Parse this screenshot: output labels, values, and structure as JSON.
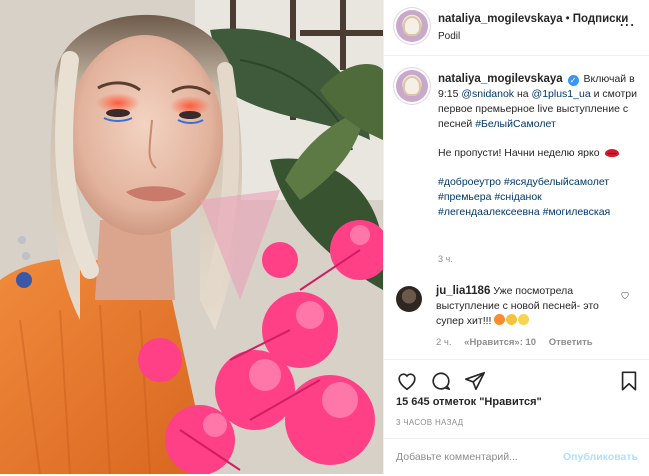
{
  "header": {
    "username": "nataliya_mogilevskaya",
    "separator": "•",
    "follow_label": "Подписки",
    "location": "Podil",
    "more_icon": "more-dots-icon"
  },
  "caption": {
    "username": "nataliya_mogilevskaya",
    "line_a_pre": "Включай в 9:15",
    "mention1": "@snidanok",
    "line_a_mid": "на",
    "mention2": "@1plus1_ua",
    "line_a_post": "и смотри первое премьерное live выступление с песней",
    "hashtag_song": "#БелыйСамолет",
    "line_b": "Не пропусти! Начни неделю ярко",
    "tags": [
      "#доброеутро",
      "#ясядубелыйсамолет",
      "#премьера",
      "#сніданок",
      "#легендаалексеевна",
      "#могилевская"
    ],
    "time": "3 ч."
  },
  "comment": {
    "username": "ju_lia1186",
    "text": "Уже посмотрела выступление с новой песней- это супер хит!!!",
    "time": "2 ч.",
    "likes": "«Нравится»: 10",
    "reply": "Ответить"
  },
  "actions": {
    "like_count": "15 645 отметок",
    "like_word": "\"Нравится\"",
    "posted_ago": "3 ЧАСОВ НАЗАД",
    "comment_placeholder": "Добавьте комментарий...",
    "post_label": "Опубликовать"
  },
  "colors": {
    "link": "#00376b",
    "verified": "#3897f0",
    "post_disabled": "#b2dffc",
    "muted": "#8e8e8e",
    "flower": "#ff3f86"
  }
}
